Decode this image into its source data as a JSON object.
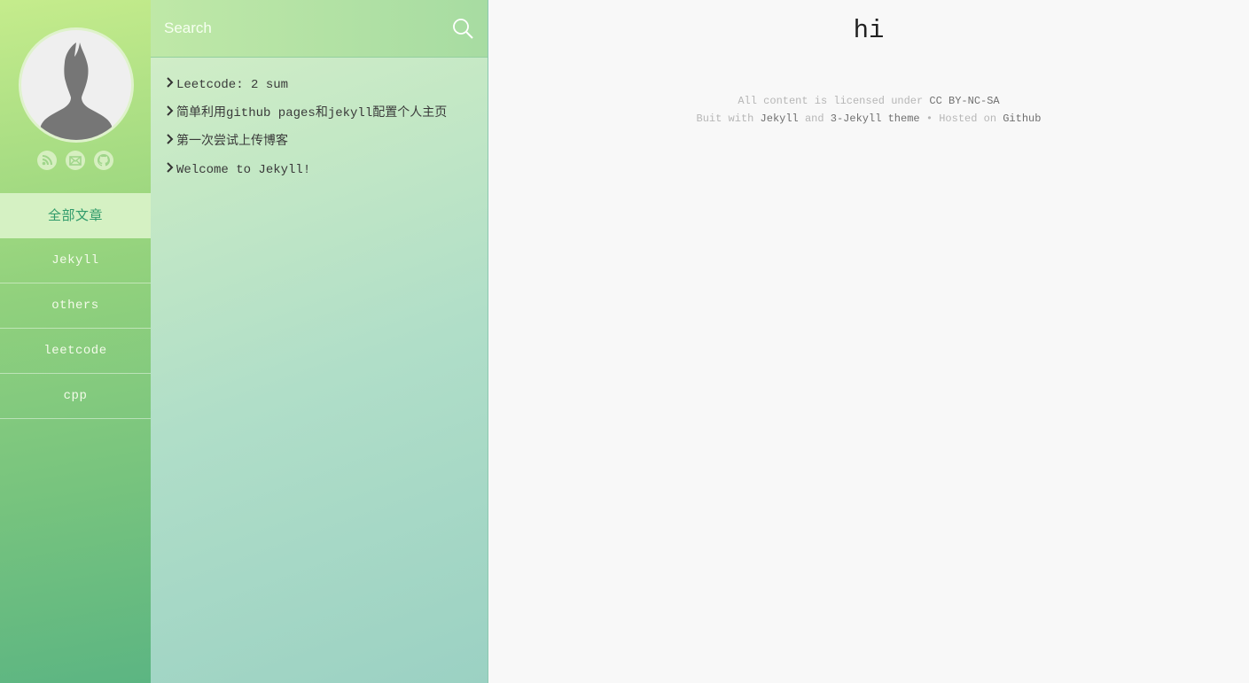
{
  "search": {
    "placeholder": "Search"
  },
  "social_icons": [
    "rss-icon",
    "email-icon",
    "github-icon"
  ],
  "nav": {
    "items": [
      {
        "label": "全部文章",
        "active": true
      },
      {
        "label": "Jekyll"
      },
      {
        "label": "others"
      },
      {
        "label": "leetcode"
      },
      {
        "label": "cpp"
      }
    ]
  },
  "posts": [
    {
      "title": "Leetcode: 2 sum"
    },
    {
      "title": "简单利用github pages和jekyll配置个人主页"
    },
    {
      "title": "第一次尝试上传博客"
    },
    {
      "title": "Welcome to Jekyll!"
    }
  ],
  "main": {
    "title": "hi"
  },
  "footer": {
    "license_prefix": "All content is licensed under",
    "license_link": "CC BY-NC-SA",
    "built_prefix": "Buit with",
    "jekyll_link": "Jekyll",
    "and": "and",
    "theme_link": "3-Jekyll theme",
    "hosted": "• Hosted on",
    "github_link": "Github"
  },
  "colors": {
    "sidebar_top": "#c5ec8c",
    "sidebar_bottom": "#5cb582",
    "active_nav_bg": "#d5f1c3",
    "active_nav_text": "#2f9a6a",
    "main_bg": "#f8f8f8"
  }
}
